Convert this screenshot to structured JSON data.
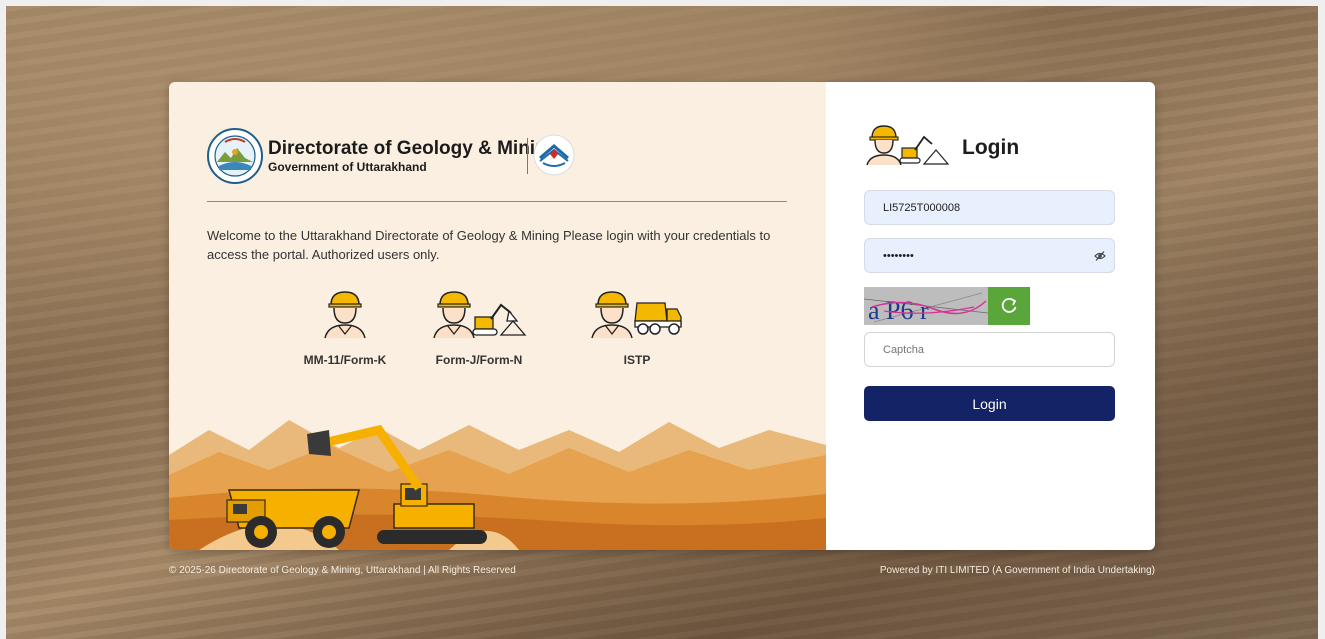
{
  "brand": {
    "org_name": "Directorate of Geology & Mining",
    "org_subtitle": "Government of Uttarakhand"
  },
  "welcome_text": "Welcome to the Uttarakhand Directorate of Geology & Mining Please login with your credentials to access the portal. Authorized users only.",
  "roles": [
    {
      "label": "MM-11/Form-K",
      "icon": "worker-icon"
    },
    {
      "label": "Form-J/Form-N",
      "icon": "worker-excavator-icon"
    },
    {
      "label": "ISTP",
      "icon": "worker-truck-icon"
    }
  ],
  "login": {
    "title": "Login",
    "username_value": "LI5725T000008",
    "password_value": "xxxxxxxx",
    "captcha_text": "a P6 r",
    "captcha_placeholder": "Captcha",
    "button_label": "Login"
  },
  "footer": {
    "copyright": "© 2025-26 Directorate of Geology & Mining, Uttarakhand | All Rights Reserved",
    "powered_by": "Powered by ITI LIMITED (A Government of India Undertaking)"
  },
  "colors": {
    "primary_button": "#142266",
    "refresh_button": "#5aa63a",
    "left_panel": "#fbefe1",
    "input_fill": "#e8f0fe"
  }
}
